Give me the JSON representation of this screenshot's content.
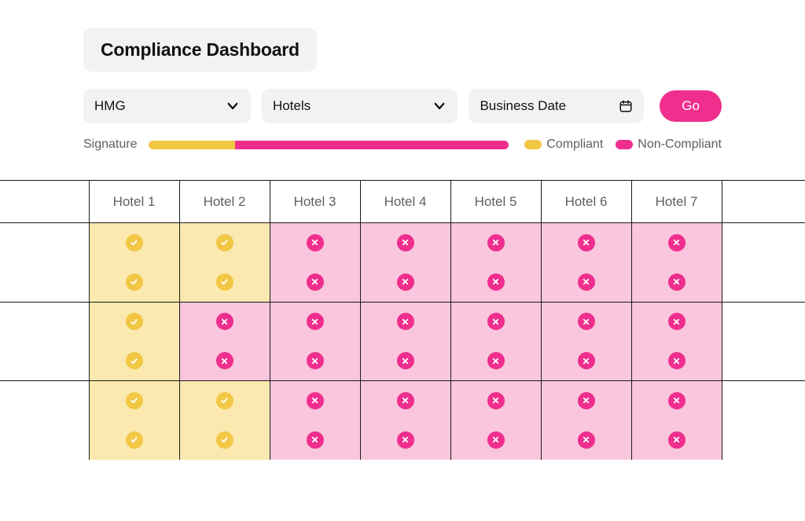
{
  "title": "Compliance Dashboard",
  "filters": {
    "hmg_label": "HMG",
    "hotels_label": "Hotels",
    "date_label": "Business Date",
    "go_label": "Go"
  },
  "signature": {
    "label": "Signature",
    "compliant_pct": 24,
    "noncompliant_pct": 76
  },
  "legend": {
    "compliant": "Compliant",
    "noncompliant": "Non-Compliant"
  },
  "colors": {
    "compliant": "#f2c744",
    "noncompliant": "#ef2e8d",
    "compliant_bg": "#fbe9b0",
    "noncompliant_bg": "#fac6dd"
  },
  "chart_data": {
    "type": "table",
    "columns": [
      "Hotel 1",
      "Hotel 2",
      "Hotel 3",
      "Hotel 4",
      "Hotel 5",
      "Hotel 6",
      "Hotel 7"
    ],
    "rows": [
      [
        "compliant",
        "compliant",
        "noncompliant",
        "noncompliant",
        "noncompliant",
        "noncompliant",
        "noncompliant"
      ],
      [
        "compliant",
        "compliant",
        "noncompliant",
        "noncompliant",
        "noncompliant",
        "noncompliant",
        "noncompliant"
      ],
      [
        "compliant",
        "noncompliant",
        "noncompliant",
        "noncompliant",
        "noncompliant",
        "noncompliant",
        "noncompliant"
      ],
      [
        "compliant",
        "noncompliant",
        "noncompliant",
        "noncompliant",
        "noncompliant",
        "noncompliant",
        "noncompliant"
      ],
      [
        "compliant",
        "compliant",
        "noncompliant",
        "noncompliant",
        "noncompliant",
        "noncompliant",
        "noncompliant"
      ],
      [
        "compliant",
        "compliant",
        "noncompliant",
        "noncompliant",
        "noncompliant",
        "noncompliant",
        "noncompliant"
      ]
    ],
    "group_breaks_after": [
      1,
      3
    ]
  }
}
